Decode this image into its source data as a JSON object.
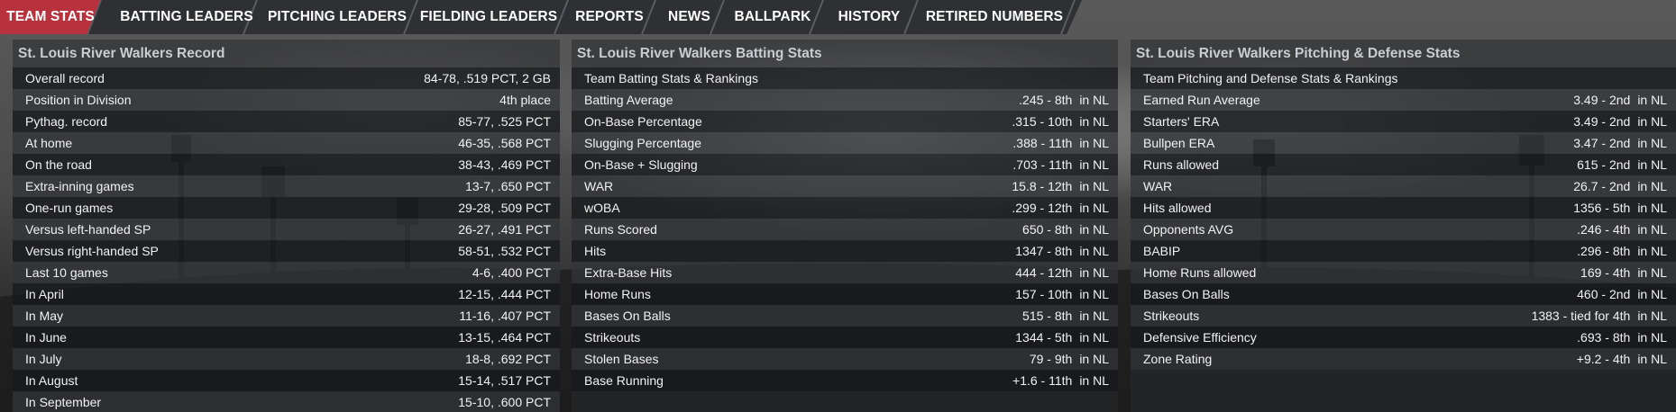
{
  "nav": {
    "tabs": [
      {
        "label": "TEAM STATS",
        "active": true
      },
      {
        "label": "BATTING LEADERS",
        "active": false
      },
      {
        "label": "PITCHING LEADERS",
        "active": false
      },
      {
        "label": "FIELDING LEADERS",
        "active": false
      },
      {
        "label": "REPORTS",
        "active": false
      },
      {
        "label": "NEWS",
        "active": false
      },
      {
        "label": "BALLPARK",
        "active": false
      },
      {
        "label": "HISTORY",
        "active": false
      },
      {
        "label": "RETIRED NUMBERS",
        "active": false
      }
    ],
    "active_color": "#b8323e"
  },
  "record": {
    "title": "St. Louis River Walkers Record",
    "rows": [
      {
        "label": "Overall record",
        "value": "84-78, .519 PCT, 2 GB"
      },
      {
        "label": "Position in Division",
        "value": "4th place"
      },
      {
        "label": "Pythag. record",
        "value": "85-77, .525 PCT"
      },
      {
        "label": "At home",
        "value": "46-35, .568 PCT"
      },
      {
        "label": "On the road",
        "value": "38-43, .469 PCT"
      },
      {
        "label": "Extra-inning games",
        "value": "13-7, .650 PCT"
      },
      {
        "label": "One-run games",
        "value": "29-28, .509 PCT"
      },
      {
        "label": "Versus left-handed SP",
        "value": "26-27, .491 PCT"
      },
      {
        "label": "Versus right-handed SP",
        "value": "58-51, .532 PCT"
      },
      {
        "label": "Last 10 games",
        "value": "4-6, .400 PCT"
      },
      {
        "label": "In April",
        "value": "12-15, .444 PCT"
      },
      {
        "label": "In May",
        "value": "11-16, .407 PCT"
      },
      {
        "label": "In June",
        "value": "13-15, .464 PCT"
      },
      {
        "label": "In July",
        "value": "18-8, .692 PCT"
      },
      {
        "label": "In August",
        "value": "15-14, .517 PCT"
      },
      {
        "label": "In September",
        "value": "15-10, .600 PCT"
      }
    ]
  },
  "batting": {
    "title": "St. Louis River Walkers Batting Stats",
    "section": "Team Batting Stats & Rankings",
    "suffix": "in NL",
    "rows": [
      {
        "label": "Batting Average",
        "value": ".245 - 8th"
      },
      {
        "label": "On-Base Percentage",
        "value": ".315 - 10th"
      },
      {
        "label": "Slugging Percentage",
        "value": ".388 - 11th"
      },
      {
        "label": "On-Base + Slugging",
        "value": ".703 - 11th"
      },
      {
        "label": "WAR",
        "value": "15.8 - 12th"
      },
      {
        "label": "wOBA",
        "value": ".299 - 12th"
      },
      {
        "label": "Runs Scored",
        "value": "650 - 8th"
      },
      {
        "label": "Hits",
        "value": "1347 - 8th"
      },
      {
        "label": "Extra-Base Hits",
        "value": "444 - 12th"
      },
      {
        "label": "Home Runs",
        "value": "157 - 10th"
      },
      {
        "label": "Bases On Balls",
        "value": "515 - 8th"
      },
      {
        "label": "Strikeouts",
        "value": "1344 - 5th"
      },
      {
        "label": "Stolen Bases",
        "value": "79 - 9th"
      },
      {
        "label": "Base Running",
        "value": "+1.6 - 11th"
      }
    ]
  },
  "pitching": {
    "title": "St. Louis River Walkers Pitching & Defense Stats",
    "section": "Team Pitching and Defense Stats & Rankings",
    "suffix": "in NL",
    "rows": [
      {
        "label": "Earned Run Average",
        "value": "3.49 - 2nd"
      },
      {
        "label": "Starters' ERA",
        "value": "3.49 - 2nd"
      },
      {
        "label": "Bullpen ERA",
        "value": "3.47 - 2nd"
      },
      {
        "label": "Runs allowed",
        "value": "615 - 2nd"
      },
      {
        "label": "WAR",
        "value": "26.7 - 2nd"
      },
      {
        "label": "Hits allowed",
        "value": "1356 - 5th"
      },
      {
        "label": "Opponents AVG",
        "value": ".246 - 4th"
      },
      {
        "label": "BABIP",
        "value": ".296 - 8th"
      },
      {
        "label": "Home Runs allowed",
        "value": "169 - 4th"
      },
      {
        "label": "Bases On Balls",
        "value": "460 - 2nd"
      },
      {
        "label": "Strikeouts",
        "value": "1383 -  tied for 4th"
      },
      {
        "label": "Defensive Efficiency",
        "value": ".693 - 8th"
      },
      {
        "label": "Zone Rating",
        "value": "+9.2 - 4th"
      }
    ]
  }
}
